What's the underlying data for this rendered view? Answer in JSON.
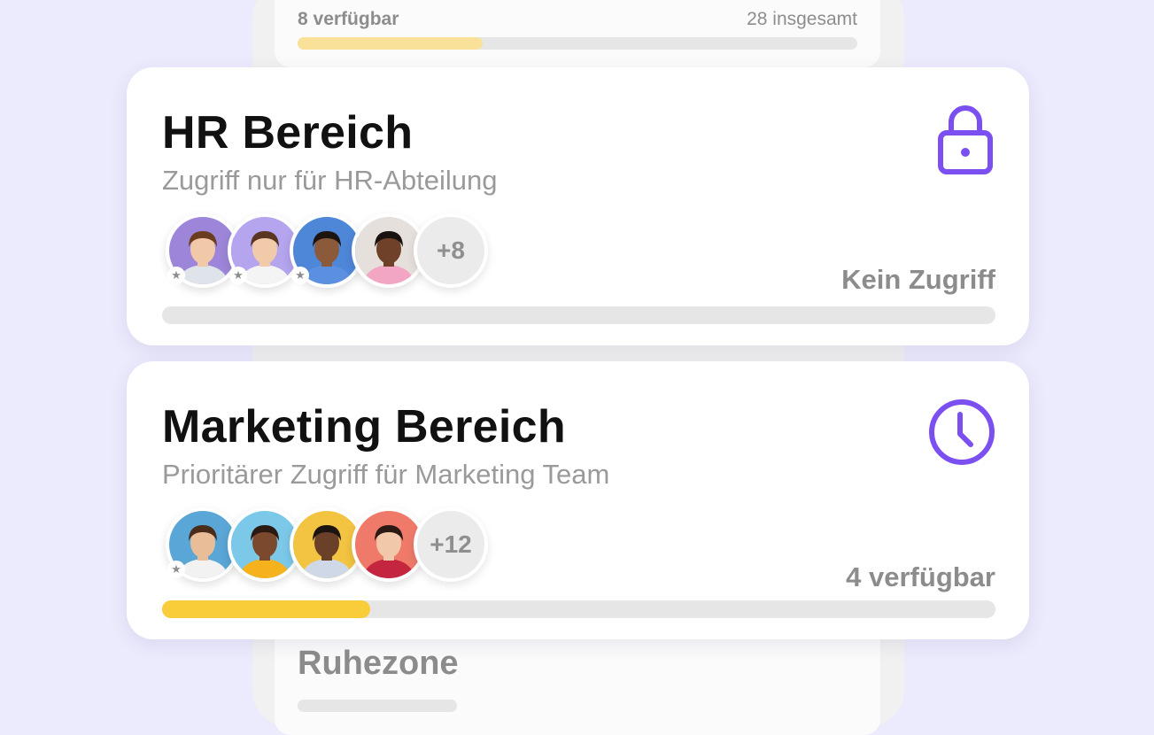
{
  "background_cards": {
    "top": {
      "available_label": "8 verfügbar",
      "total_label": "28 insgesamt",
      "fill_fraction": 0.33
    },
    "bottom": {
      "title": "Ruhezone"
    }
  },
  "areas": [
    {
      "title": "HR Bereich",
      "subtitle": "Zugriff nur für HR-Abteilung",
      "status_icon": "lock-icon",
      "extra_members": "+8",
      "availability_label": "Kein Zugriff",
      "fill_fraction": 0,
      "avatars": [
        {
          "bg": "#9d86d9",
          "skin": "#f2c9a8",
          "hair": "#6b3d1f",
          "shirt": "#dfe3ea",
          "star": true
        },
        {
          "bg": "#b5a4ee",
          "skin": "#f1caa9",
          "hair": "#5a3522",
          "shirt": "#f4f4f4",
          "star": true
        },
        {
          "bg": "#4e86d8",
          "skin": "#8a5a3b",
          "hair": "#1d1410",
          "shirt": "#5b8fe0",
          "star": true
        },
        {
          "bg": "#e6e0dc",
          "skin": "#6e4128",
          "hair": "#1a1210",
          "shirt": "#f2a6c4",
          "star": false
        }
      ]
    },
    {
      "title": "Marketing Bereich",
      "subtitle": "Prioritärer Zugriff für Marketing Team",
      "status_icon": "clock-icon",
      "extra_members": "+12",
      "availability_label": "4 verfügbar",
      "fill_fraction": 0.25,
      "avatars": [
        {
          "bg": "#5aa6d6",
          "skin": "#e9bd98",
          "hair": "#4a2c18",
          "shirt": "#f2f2f2",
          "star": true
        },
        {
          "bg": "#7cc8e8",
          "skin": "#7b4a2e",
          "hair": "#2a1a12",
          "shirt": "#f6b21c",
          "star": false
        },
        {
          "bg": "#f3c342",
          "skin": "#6b4028",
          "hair": "#1b1410",
          "shirt": "#cfd8e6",
          "star": false
        },
        {
          "bg": "#ef7a6a",
          "skin": "#f1c8aa",
          "hair": "#2b1a14",
          "shirt": "#c3263e",
          "star": false
        }
      ]
    }
  ],
  "colors": {
    "accent": "#7b4ff0",
    "progress_fill": "#f9cd3a",
    "progress_fill_light": "#f9e19a",
    "track": "#e6e6e6",
    "muted_text": "#8c8c8c"
  }
}
